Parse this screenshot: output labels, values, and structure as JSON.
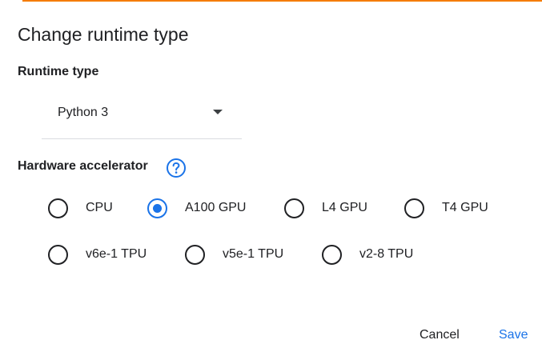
{
  "dialog": {
    "title": "Change runtime type",
    "accent_color": "#f57c00"
  },
  "runtime": {
    "label": "Runtime type",
    "selected": "Python 3"
  },
  "hardware": {
    "label": "Hardware accelerator",
    "help_icon": "help-circle-icon",
    "selected": "A100 GPU",
    "options": [
      {
        "label": "CPU",
        "checked": false
      },
      {
        "label": "A100 GPU",
        "checked": true
      },
      {
        "label": "L4 GPU",
        "checked": false
      },
      {
        "label": "T4 GPU",
        "checked": false
      },
      {
        "label": "v6e-1 TPU",
        "checked": false
      },
      {
        "label": "v5e-1 TPU",
        "checked": false
      },
      {
        "label": "v2-8 TPU",
        "checked": false
      }
    ],
    "selected_color": "#1a73e8"
  },
  "actions": {
    "cancel_label": "Cancel",
    "save_label": "Save",
    "save_color": "#1a73e8"
  }
}
